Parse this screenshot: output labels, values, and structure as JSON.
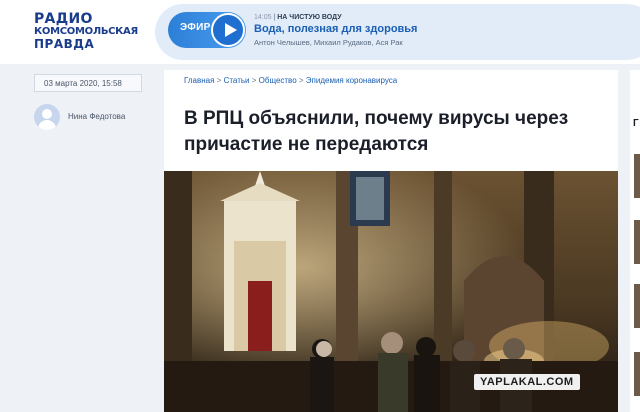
{
  "brand": {
    "line1": "РАДИО",
    "line2": "КОМСОМОЛЬСКАЯ",
    "line3": "ПРАВДА"
  },
  "on_air": {
    "label": "ЭФИР",
    "time": "14:05",
    "show": "НА ЧИСТУЮ ВОДУ",
    "title": "Вода, полезная для здоровья",
    "hosts": "Антон Челышев, Михаил Рудаков, Ася Рак"
  },
  "meta": {
    "date": "03 марта 2020, 15:58",
    "author": "Нина Федотова"
  },
  "breadcrumb": [
    "Главная",
    "Статьи",
    "Общество",
    "Эпидемия коронавируса"
  ],
  "breadcrumb_sep": " > ",
  "article": {
    "headline": "В РПЦ объяснили, почему вирусы через причастие не передаются"
  },
  "watermark": "YAPLAKAL.COM",
  "edge": {
    "letter": "Г"
  }
}
